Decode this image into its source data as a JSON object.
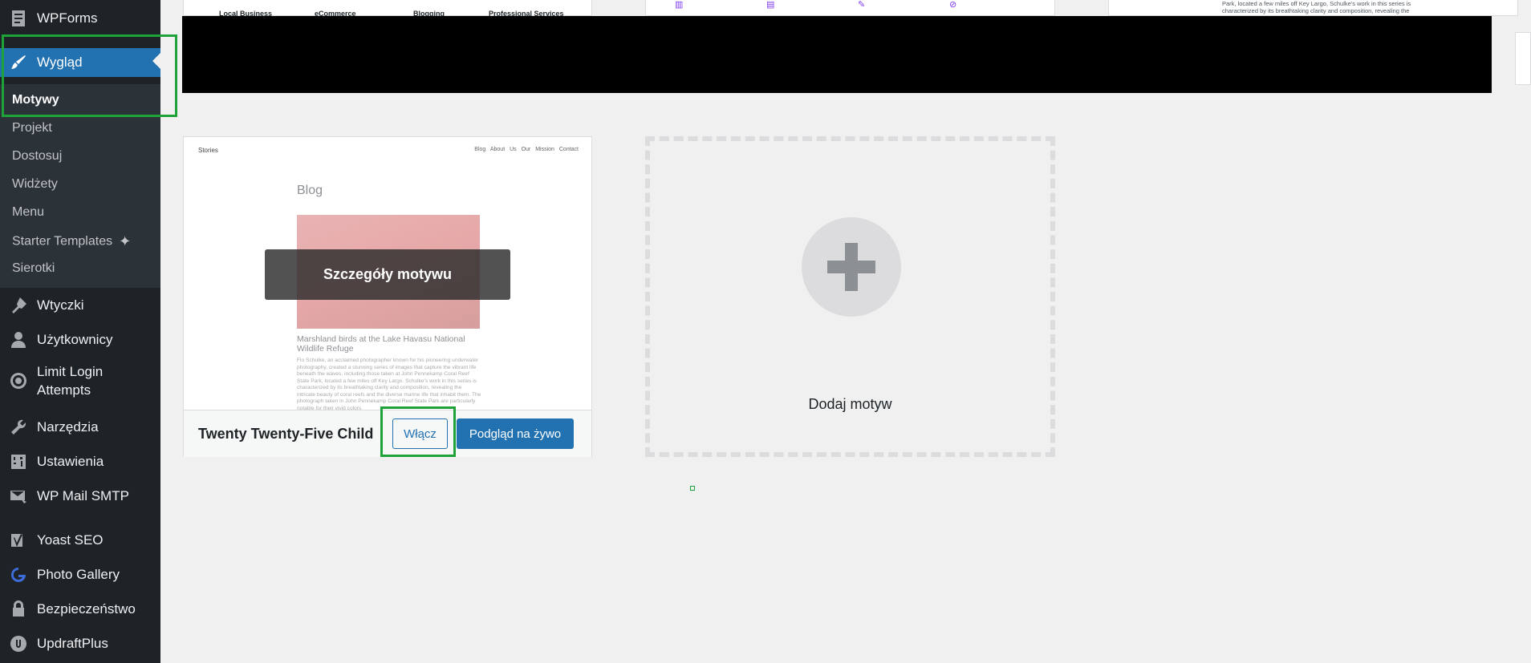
{
  "sidebar": {
    "items": [
      {
        "label": "WPForms",
        "icon": "wpforms-icon"
      },
      {
        "label": "Wygląd",
        "icon": "paintbrush-icon",
        "current": true
      },
      {
        "label": "Wtyczki",
        "icon": "plugins-icon"
      },
      {
        "label": "Użytkownicy",
        "icon": "users-icon"
      },
      {
        "label": "Limit Login Attempts",
        "icon": "limit-login-icon"
      },
      {
        "label": "Narzędzia",
        "icon": "tools-icon"
      },
      {
        "label": "Ustawienia",
        "icon": "settings-icon"
      },
      {
        "label": "WP Mail SMTP",
        "icon": "mail-icon"
      },
      {
        "label": "Yoast SEO",
        "icon": "yoast-icon"
      },
      {
        "label": "Photo Gallery",
        "icon": "gallery-icon"
      },
      {
        "label": "Bezpieczeństwo",
        "icon": "lock-icon"
      },
      {
        "label": "UpdraftPlus",
        "icon": "updraft-icon"
      }
    ],
    "submenu": [
      "Motywy",
      "Projekt",
      "Dostosuj",
      "Widżety",
      "Menu",
      "Starter Templates",
      "Sierotki"
    ]
  },
  "top_cards": {
    "categories": [
      "Local Business",
      "eCommerce",
      "Blogging",
      "Professional Services"
    ],
    "right_text": "Park, located a few miles off Key Largo, Schulke's work in this series is characterized by its breathtaking clarity and composition, revealing the"
  },
  "theme": {
    "preview": {
      "site_title": "Stories",
      "nav": "Blog About Us Our Mission Contact",
      "heading": "Blog",
      "caption": "Marshland birds at the Lake Havasu National Wildlife Refuge",
      "paragraph": "Flo Schulke, an acclaimed photographer known for his pioneering underwater photography, created a stunning series of images that capture the vibrant life beneath the waves, including those taken at John Pennekamp Coral Reef State Park, located a few miles off Key Largo. Schulke's work in this series is characterized by its breathtaking clarity and composition, revealing the intricate beauty of coral reefs and the diverse marine life that inhabit them. The photograph taken in John Pennekamp Coral Reef State Park are particularly notable for their vivid colors"
    },
    "details_label": "Szczegóły motywu",
    "name": "Twenty Twenty-Five Child",
    "activate_label": "Włącz",
    "preview_label": "Podgląd na żywo"
  },
  "add_theme": {
    "label": "Dodaj motyw"
  },
  "colors": {
    "accent": "#2271b1",
    "sidebar": "#1d2327",
    "highlight": "#1fa23a"
  }
}
